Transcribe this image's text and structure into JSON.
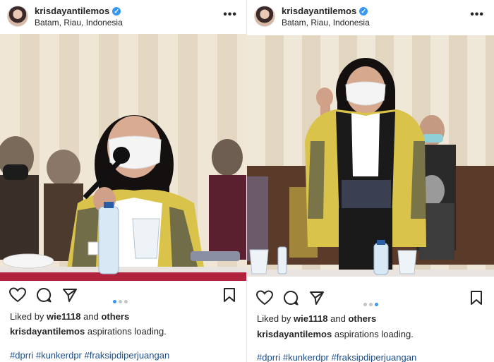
{
  "posts": [
    {
      "username": "krisdayantilemos",
      "location": "Batam, Riau, Indonesia",
      "liked_prefix": "Liked by",
      "liked_user": "wie1118",
      "liked_and": "and",
      "liked_others": "others",
      "caption_user": "krisdayantilemos",
      "caption_text": "aspirations loading.",
      "hashtags": "#dprri #kunkerdpr #fraksipdiperjuangan",
      "carousel": {
        "count": 3,
        "active": 1
      }
    },
    {
      "username": "krisdayantilemos",
      "location": "Batam, Riau, Indonesia",
      "liked_prefix": "Liked by",
      "liked_user": "wie1118",
      "liked_and": "and",
      "liked_others": "others",
      "caption_user": "krisdayantilemos",
      "caption_text": "aspirations loading.",
      "hashtags": "#dprri #kunkerdpr #fraksipdiperjuangan",
      "carousel": {
        "count": 3,
        "active": 3
      }
    }
  ],
  "icons": {
    "verified": "verified-badge-icon",
    "more": "more-options-icon",
    "like": "heart-icon",
    "comment": "comment-icon",
    "share": "share-icon",
    "save": "bookmark-icon"
  },
  "colors": {
    "accent": "#3897f0",
    "hashtag": "#1b4d8a",
    "text": "#262626"
  }
}
